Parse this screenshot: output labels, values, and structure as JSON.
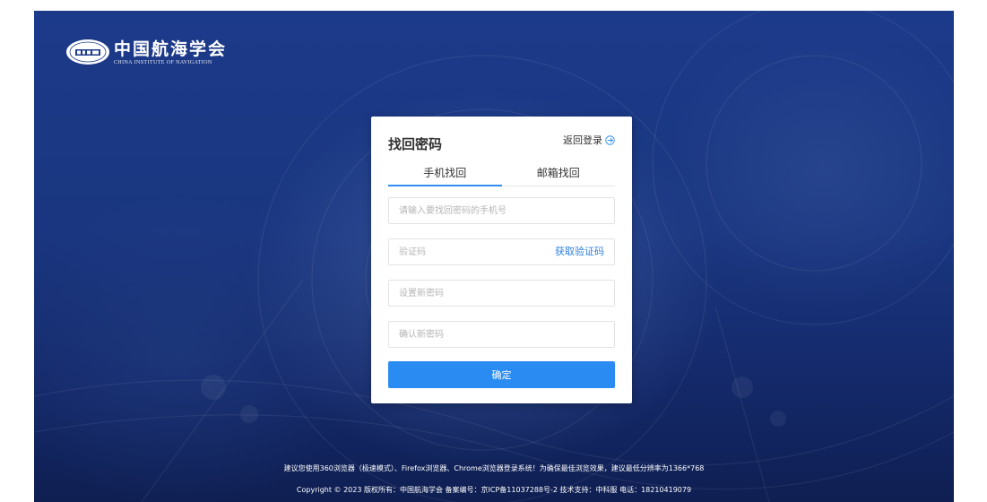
{
  "logo": {
    "name_cn": "中国航海学会",
    "name_en": "CHINA INSTITUTE OF NAVIGATION"
  },
  "form": {
    "title": "找回密码",
    "back_label": "返回登录",
    "tabs": [
      {
        "label": "手机找回",
        "active": true
      },
      {
        "label": "邮箱找回",
        "active": false
      }
    ],
    "phone_placeholder": "请输入要找回密码的手机号",
    "code_placeholder": "验证码",
    "get_code_label": "获取验证码",
    "new_password_placeholder": "设置新密码",
    "confirm_password_placeholder": "确认新密码",
    "submit_label": "确定"
  },
  "footer": {
    "notice": "建议您使用360浏览器（极速模式）、Firefox浏览器、Chrome浏览器登录系统！为确保最佳浏览效果，建议最低分辨率为1366*768",
    "copyright": "Copyright © 2023 版权所有：中国航海学会 备案编号：京ICP备11037288号-2 技术支持：中科服  电话：18210419079"
  },
  "colors": {
    "background": "#1c3a8a",
    "accent": "#2a8cf2",
    "link": "#2f7fe0"
  }
}
